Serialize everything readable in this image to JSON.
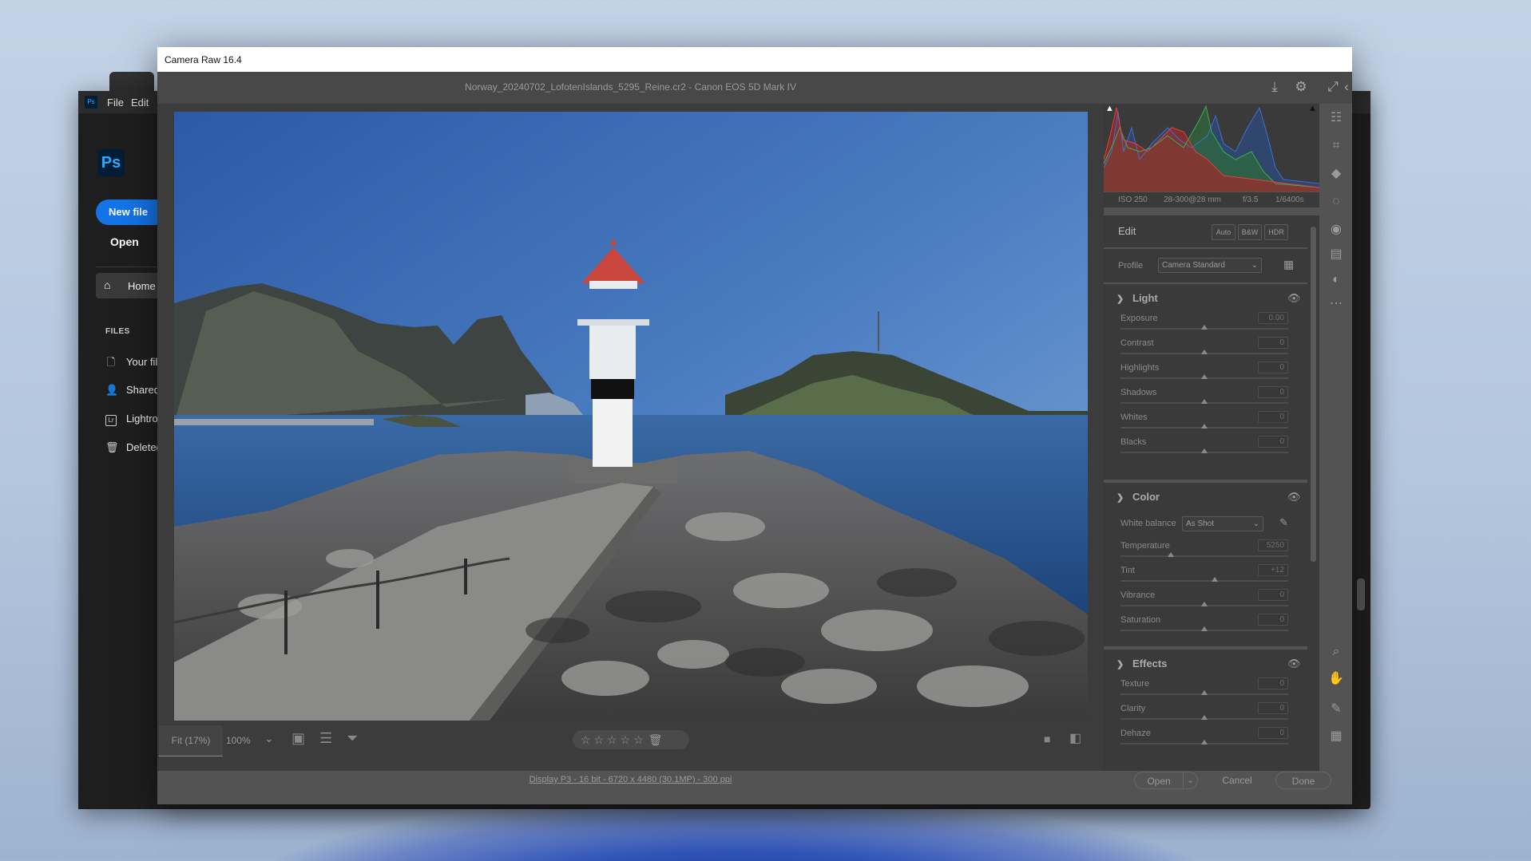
{
  "photoshop": {
    "menu": [
      "File",
      "Edit"
    ],
    "logo": "Ps",
    "new_file": "New file",
    "open": "Open",
    "home": "Home",
    "files_heading": "FILES",
    "items": [
      {
        "label": "Your files",
        "icon": "file-icon"
      },
      {
        "label": "Shared with you",
        "icon": "shared-users-icon"
      },
      {
        "label": "Lightroom photos",
        "icon": "lightroom-icon"
      },
      {
        "label": "Deleted",
        "icon": "trash-icon"
      }
    ]
  },
  "camera_raw": {
    "window_title": "Camera Raw 16.4",
    "file_title": "Norway_20240702_LofotenIslands_5295_Reine.cr2  -  Canon EOS 5D Mark IV",
    "histogram_info": {
      "iso": "ISO 250",
      "lens": "28-300@28 mm",
      "aperture": "f/3.5",
      "shutter": "1/6400s"
    },
    "edit": {
      "title": "Edit",
      "buttons": [
        "Auto",
        "B&W",
        "HDR"
      ]
    },
    "profile": {
      "label": "Profile",
      "value": "Camera Standard"
    },
    "light": {
      "title": "Light",
      "sliders": [
        {
          "label": "Exposure",
          "value": "0.00",
          "pos": 0.5
        },
        {
          "label": "Contrast",
          "value": "0",
          "pos": 0.5
        },
        {
          "label": "Highlights",
          "value": "0",
          "pos": 0.5
        },
        {
          "label": "Shadows",
          "value": "0",
          "pos": 0.5
        },
        {
          "label": "Whites",
          "value": "0",
          "pos": 0.5
        },
        {
          "label": "Blacks",
          "value": "0",
          "pos": 0.5
        }
      ]
    },
    "color": {
      "title": "Color",
      "wb_label": "White balance",
      "wb_value": "As Shot",
      "sliders": [
        {
          "label": "Temperature",
          "value": "5250",
          "pos": 0.3
        },
        {
          "label": "Tint",
          "value": "+12",
          "pos": 0.56
        },
        {
          "label": "Vibrance",
          "value": "0",
          "pos": 0.5
        },
        {
          "label": "Saturation",
          "value": "0",
          "pos": 0.5
        }
      ]
    },
    "effects": {
      "title": "Effects",
      "sliders": [
        {
          "label": "Texture",
          "value": "0",
          "pos": 0.5
        },
        {
          "label": "Clarity",
          "value": "0",
          "pos": 0.5
        },
        {
          "label": "Dehaze",
          "value": "0",
          "pos": 0.5
        }
      ]
    },
    "zoom": {
      "fit": "Fit (17%)",
      "pct": "100%"
    },
    "info_link": "Display P3 - 16 bit - 6720 x 4480 (30.1MP) - 300 ppi",
    "footer": {
      "open": "Open",
      "cancel": "Cancel",
      "done": "Done"
    }
  }
}
